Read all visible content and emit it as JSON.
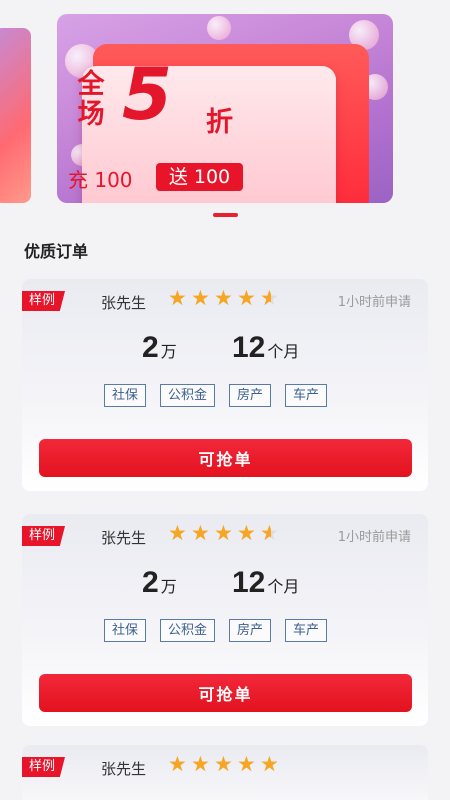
{
  "banner": {
    "promo_vertical": "全场",
    "promo_number": "5",
    "promo_unit": "折",
    "promo_charge": "充 100",
    "promo_gift": "送 100",
    "colors": {
      "accent": "#e4162b",
      "banner_bg": "#c98ad9"
    }
  },
  "section": {
    "title": "优质订单"
  },
  "orders": [
    {
      "tag": "样例",
      "name": "张先生",
      "rating": 4.5,
      "time": "1小时前申请",
      "amount": "2",
      "amount_unit": "万",
      "term": "12",
      "term_unit": "个月",
      "tags": [
        "社保",
        "公积金",
        "房产",
        "车产"
      ],
      "button": "可抢单"
    },
    {
      "tag": "样例",
      "name": "张先生",
      "rating": 4.5,
      "time": "1小时前申请",
      "amount": "2",
      "amount_unit": "万",
      "term": "12",
      "term_unit": "个月",
      "tags": [
        "社保",
        "公积金",
        "房产",
        "车产"
      ],
      "button": "可抢单"
    },
    {
      "tag": "样例",
      "name": "张先生",
      "rating": 5
    }
  ],
  "icons": {
    "star": "star-icon"
  },
  "colors": {
    "primary": "#e8142a",
    "star": "#f6a623",
    "tag_border": "#5a7ba8"
  }
}
